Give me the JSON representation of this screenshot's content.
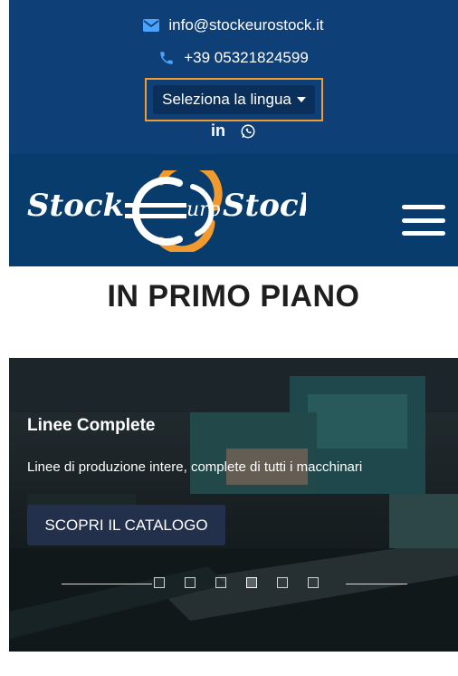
{
  "header": {
    "email": "info@stockeurostock.it",
    "phone": "+39 05321824599",
    "language_button": "Seleziona la lingua",
    "social": {
      "linkedin_label": "in"
    }
  },
  "brand": {
    "logo_alt": "StockEuroStock"
  },
  "section": {
    "title": "IN PRIMO PIANO"
  },
  "carousel": {
    "headline": "Linee Complete",
    "description": "Linee di produzione intere, complete di tutti i macchinari",
    "cta_label": "SCOPRI IL CATALOGO",
    "slide_count": 6,
    "active_index": 3
  },
  "colors": {
    "top_bar": "#0f3f77",
    "logo_bar": "#083c6c",
    "accent": "#f29a2e",
    "cta_bg": "#22304b"
  },
  "icons": [
    "envelope-icon",
    "phone-icon",
    "linkedin-icon",
    "whatsapp-icon",
    "hamburger-menu-icon"
  ]
}
